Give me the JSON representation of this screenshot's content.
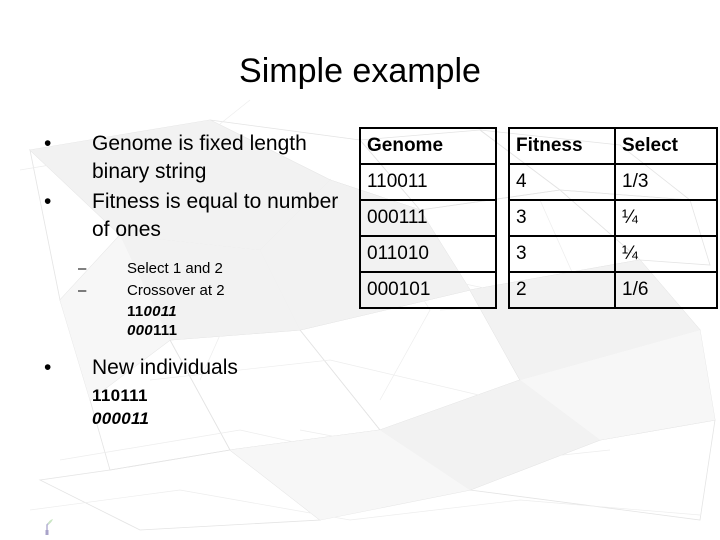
{
  "slide": {
    "title": "Simple example",
    "background_color": "#ffffff",
    "text_color": "#000000",
    "watermark_color": "#e8e8e8"
  },
  "body": {
    "bullets": [
      {
        "marker": "•",
        "text": "Genome is fixed length binary string"
      },
      {
        "marker": "•",
        "text": "Fitness is equal to number of ones"
      }
    ],
    "sub_bullets": [
      {
        "marker": "–",
        "text": "Select 1 and 2"
      },
      {
        "marker": "–",
        "text": "Crossover at 2"
      }
    ],
    "crossover_strings": [
      {
        "bold_part": "11",
        "italic_part": "0011"
      },
      {
        "italic_part": "000",
        "bold_part": "111"
      }
    ],
    "new_bullet": {
      "marker": "•",
      "text": "New individuals"
    },
    "new_individuals": [
      {
        "text": "110111",
        "style": "bold"
      },
      {
        "text": "000011",
        "style": "italic"
      }
    ]
  },
  "genome_table": {
    "header": "Genome",
    "rows": [
      "110011",
      "000111",
      "011010",
      "000101"
    ]
  },
  "fitness_table": {
    "headers": [
      "Fitness",
      "Select"
    ],
    "rows": [
      {
        "fitness": "4",
        "select": "1/3"
      },
      {
        "fitness": "3",
        "select": "¼"
      },
      {
        "fitness": "3",
        "select": "¼"
      },
      {
        "fitness": "2",
        "select": "1/6"
      }
    ]
  },
  "footer": {
    "logo_mark": "small-faint-logo"
  }
}
